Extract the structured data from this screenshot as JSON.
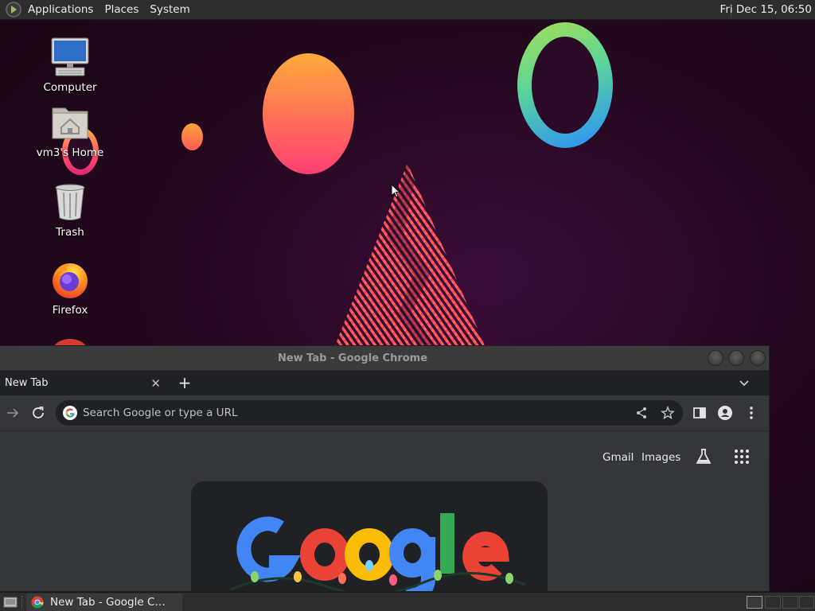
{
  "top_panel": {
    "menus": [
      "Applications",
      "Places",
      "System"
    ],
    "clock": "Fri Dec 15, 06:50"
  },
  "desktop_icons": [
    {
      "label": "Computer",
      "icon": "computer-icon"
    },
    {
      "label": "vm3's Home",
      "icon": "home-folder-icon"
    },
    {
      "label": "Trash",
      "icon": "trash-icon"
    },
    {
      "label": "Firefox",
      "icon": "firefox-icon"
    }
  ],
  "chrome": {
    "window_title": "New Tab - Google Chrome",
    "tab_label": "New Tab",
    "tab_close": "✕",
    "new_tab": "+",
    "omnibox_placeholder": "Search Google or type a URL",
    "links": {
      "gmail": "Gmail",
      "images": "Images"
    }
  },
  "taskbar": {
    "task_label": "New Tab - Google C…"
  },
  "colors": {
    "panel": "#2d2d2d",
    "chrome_frame": "#35363a",
    "chrome_tabstrip": "#202124",
    "wallpaper": "#24081f"
  }
}
